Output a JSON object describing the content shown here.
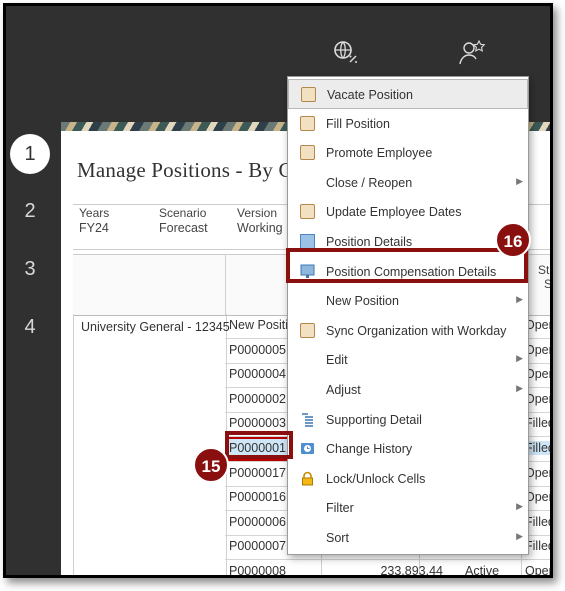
{
  "steps": [
    "1",
    "2",
    "3",
    "4"
  ],
  "page": {
    "title": "Manage Positions - By C"
  },
  "pov": {
    "years_label": "Years",
    "years_value": "FY24",
    "scenario_label": "Scenario",
    "scenario_value": "Forecast",
    "version_label": "Version",
    "version_value": "Working"
  },
  "grid": {
    "status_header_line1": "St",
    "status_header_line2": "S",
    "row_group": "University General - 12345",
    "rows": [
      {
        "id": "New Positio",
        "status": "Oper"
      },
      {
        "id": "P0000005",
        "status": "Oper"
      },
      {
        "id": "P0000004",
        "status": "Oper"
      },
      {
        "id": "P0000002",
        "status": "Oper"
      },
      {
        "id": "P0000003",
        "status": "Filled"
      },
      {
        "id": "P0000001",
        "status": "Filled"
      },
      {
        "id": "P0000017",
        "status": "Oper"
      },
      {
        "id": "P0000016",
        "status": "Oper"
      },
      {
        "id": "P0000006",
        "status": "Filled"
      },
      {
        "id": "P0000007",
        "status": "Filled"
      },
      {
        "id": "P0000008",
        "amount": "233,893.44",
        "active": "Active",
        "status": "Oper"
      }
    ]
  },
  "menu": [
    {
      "label": "Vacate Position",
      "icon": "form-icon"
    },
    {
      "label": "Fill Position",
      "icon": "form-icon"
    },
    {
      "label": "Promote Employee",
      "icon": "form-icon"
    },
    {
      "label": "Close / Reopen",
      "submenu": true
    },
    {
      "label": "Update Employee Dates",
      "icon": "form-icon"
    },
    {
      "label": "Position Details",
      "icon": "grid-icon"
    },
    {
      "label": "Position Compensation Details",
      "icon": "dashboard-icon"
    },
    {
      "label": "New Position",
      "submenu": true
    },
    {
      "label": "Sync Organization with Workday",
      "icon": "form-icon"
    },
    {
      "label": "Edit",
      "submenu": true
    },
    {
      "label": "Adjust",
      "submenu": true
    },
    {
      "label": "Supporting Detail",
      "icon": "supporting-detail-icon"
    },
    {
      "label": "Change History",
      "icon": "history-icon"
    },
    {
      "label": "Lock/Unlock Cells",
      "icon": "lock-icon"
    },
    {
      "label": "Filter",
      "submenu": true
    },
    {
      "label": "Sort",
      "submenu": true
    }
  ],
  "callouts": {
    "menu_badge": "16",
    "cell_badge": "15"
  },
  "colors": {
    "callout": "#8a1010",
    "frame": "#303030",
    "selection": "#cfe6f7"
  }
}
